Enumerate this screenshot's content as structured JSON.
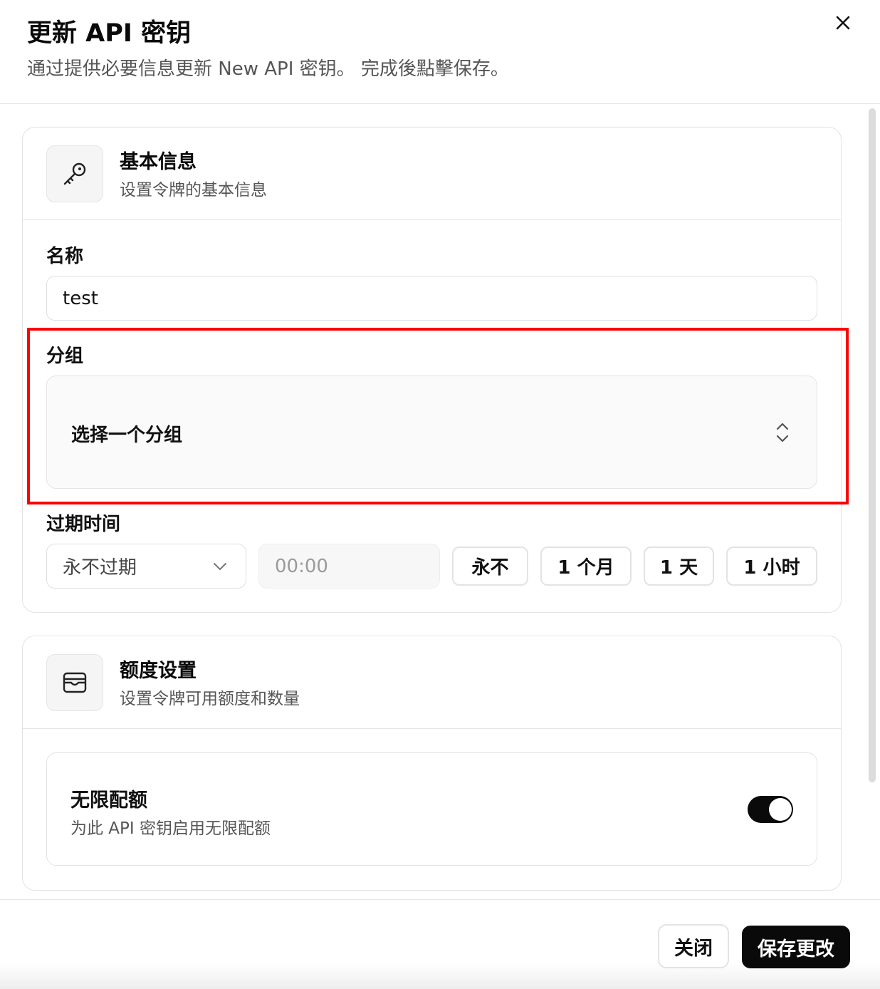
{
  "dialog": {
    "title": "更新 API 密钥",
    "subtitle": "通过提供必要信息更新 New API 密钥。 完成後點擊保存。"
  },
  "basic": {
    "title": "基本信息",
    "desc": "设置令牌的基本信息",
    "icon": "key-icon",
    "name_label": "名称",
    "name_value": "test",
    "group_label": "分组",
    "group_placeholder": "选择一个分组",
    "expiry_label": "过期时间",
    "expiry_select": "永不过期",
    "time_placeholder": "00:00",
    "presets": [
      "永不",
      "1 个月",
      "1 天",
      "1 小时"
    ]
  },
  "quota": {
    "title": "额度设置",
    "desc": "设置令牌可用额度和数量",
    "icon": "wallet-icon",
    "unlimited_title": "无限配额",
    "unlimited_desc": "为此 API 密钥启用无限配额",
    "unlimited_on": true
  },
  "footer": {
    "close_label": "关闭",
    "save_label": "保存更改"
  },
  "colors": {
    "accent": "#0a0a0a",
    "highlight": "#ff0000"
  }
}
